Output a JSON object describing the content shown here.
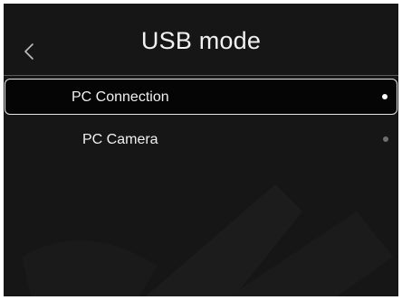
{
  "header": {
    "title": "USB mode",
    "back_icon": "chevron-left-icon"
  },
  "menu": {
    "items": [
      {
        "label": "PC Connection",
        "selected": true
      },
      {
        "label": "PC Camera",
        "selected": false
      }
    ]
  },
  "colors": {
    "background": "#161616",
    "text": "#f0f0f0",
    "divider": "#5a5a5a",
    "selection_border": "#e6e6e6",
    "selected_dot": "#ffffff",
    "unselected_dot": "#6e6e6e"
  }
}
